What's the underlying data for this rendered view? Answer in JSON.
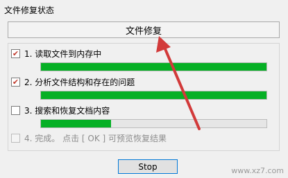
{
  "window": {
    "title": "文件修复状态"
  },
  "header": {
    "label": "文件修复"
  },
  "steps": [
    {
      "label": "1. 读取文件到内存中",
      "checked": true,
      "progress": 1.0
    },
    {
      "label": "2. 分析文件结构和存在的问题",
      "checked": true,
      "progress": 1.0
    },
    {
      "label": "3. 搜索和恢复文档内容",
      "checked": false,
      "progress": 0.31
    },
    {
      "label": "4. 完成。 点击 [ OK ] 可预览恢复结果",
      "checked": false,
      "disabled": true
    }
  ],
  "check_mark": "✔",
  "progress_color": "#06b025",
  "arrow_color": "#d23a3a",
  "stop_button": {
    "label": "Stop"
  },
  "watermark": {
    "text": "www.xz7.com"
  }
}
